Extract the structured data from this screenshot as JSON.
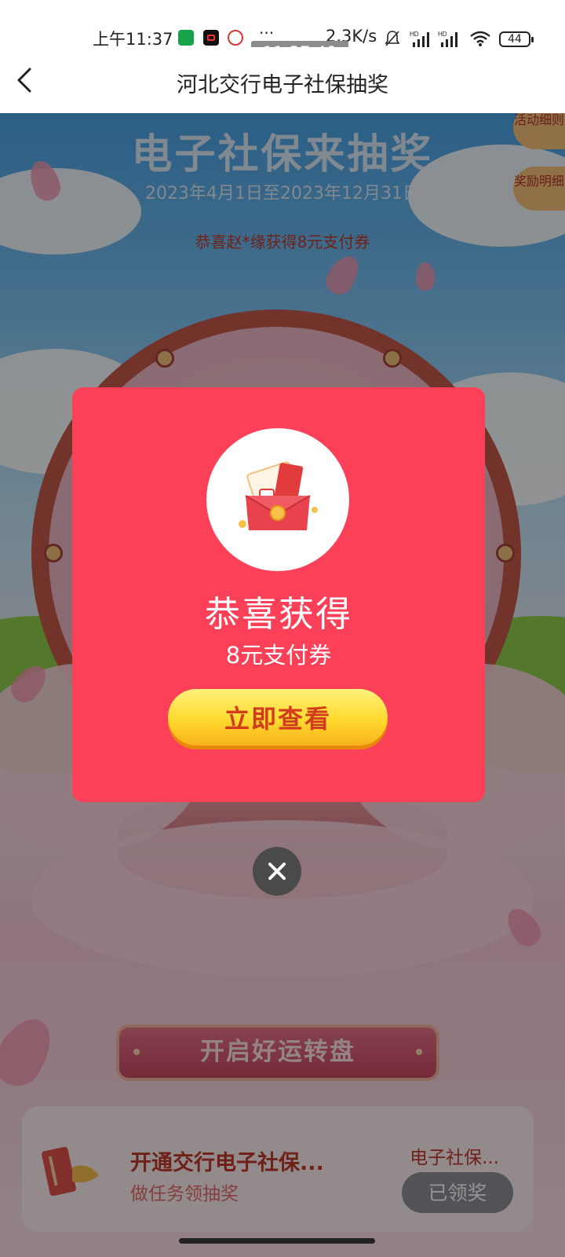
{
  "status_bar": {
    "time": "上午11:37",
    "screen_recording_time": "11:37:40",
    "more": "···",
    "network_speed": "2.3K/s",
    "battery": "44",
    "icons": [
      "app-green-icon",
      "app-video-icon",
      "app-red-icon",
      "bell-muted-icon",
      "signal-hd-icon",
      "signal-hd-icon",
      "wifi-icon",
      "battery-icon"
    ]
  },
  "header": {
    "title": "河北交行电子社保抽奖",
    "back_icon": "chevron-left-icon"
  },
  "banner": {
    "title": "电子社保来抽奖",
    "dates": "2023年4月1日至2023年12月31日",
    "ticker": "恭喜赵*缘获得8元支付券"
  },
  "side_tabs": {
    "rules": "活动细则",
    "rewards": "奖励明细"
  },
  "spin_banner": "开启好运转盘",
  "task": {
    "title": "开通交行电子社保...",
    "subtitle": "做任务领抽奖",
    "right_label": "电子社保...",
    "button": "已领奖"
  },
  "modal": {
    "title": "恭喜获得",
    "prize": "8元支付券",
    "button": "立即查看",
    "icon": "red-envelope-coupon-icon",
    "close_icon": "close-icon"
  },
  "colors": {
    "modal_bg": "#fb4057",
    "button_yellow": "#ffd92e",
    "button_text": "#d33b1d"
  }
}
